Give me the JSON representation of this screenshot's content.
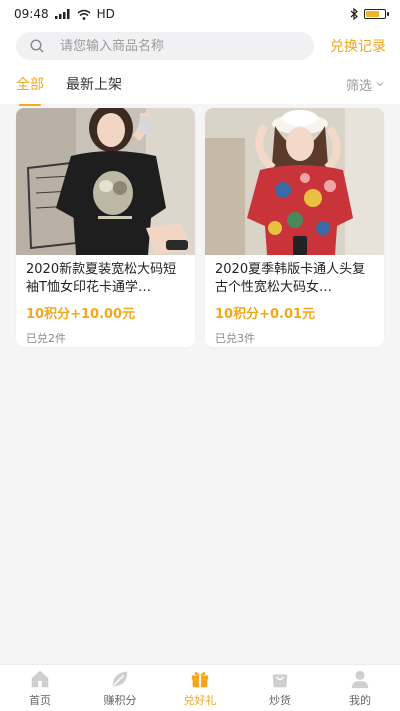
{
  "status_bar": {
    "time": "09:48",
    "network": "HD"
  },
  "search": {
    "placeholder": "请您输入商品名称",
    "exchange_label": "兑换记录"
  },
  "tabs": [
    {
      "label": "全部",
      "active": true
    },
    {
      "label": "最新上架",
      "active": false
    }
  ],
  "filter": {
    "label": "筛选"
  },
  "products": [
    {
      "title": "2020新款夏装宽松大码短袖T恤女印花卡通学…",
      "price": "10积分+10.00元",
      "sold": "已兑2件",
      "image": "woman in black cartoon t-shirt"
    },
    {
      "title": "2020夏季韩版卡通人头复古个性宽松大码女…",
      "price": "10积分+0.01元",
      "sold": "已兑3件",
      "image": "woman in red patterned shirt"
    }
  ],
  "bottom_nav": [
    {
      "label": "首页",
      "icon": "home-icon"
    },
    {
      "label": "赚积分",
      "icon": "leaf-icon"
    },
    {
      "label": "兑好礼",
      "icon": "gift-icon",
      "active": true
    },
    {
      "label": "炒货",
      "icon": "bag-icon"
    },
    {
      "label": "我的",
      "icon": "user-icon"
    }
  ],
  "colors": {
    "accent": "#f3a81c",
    "background": "#f5f5f5"
  }
}
